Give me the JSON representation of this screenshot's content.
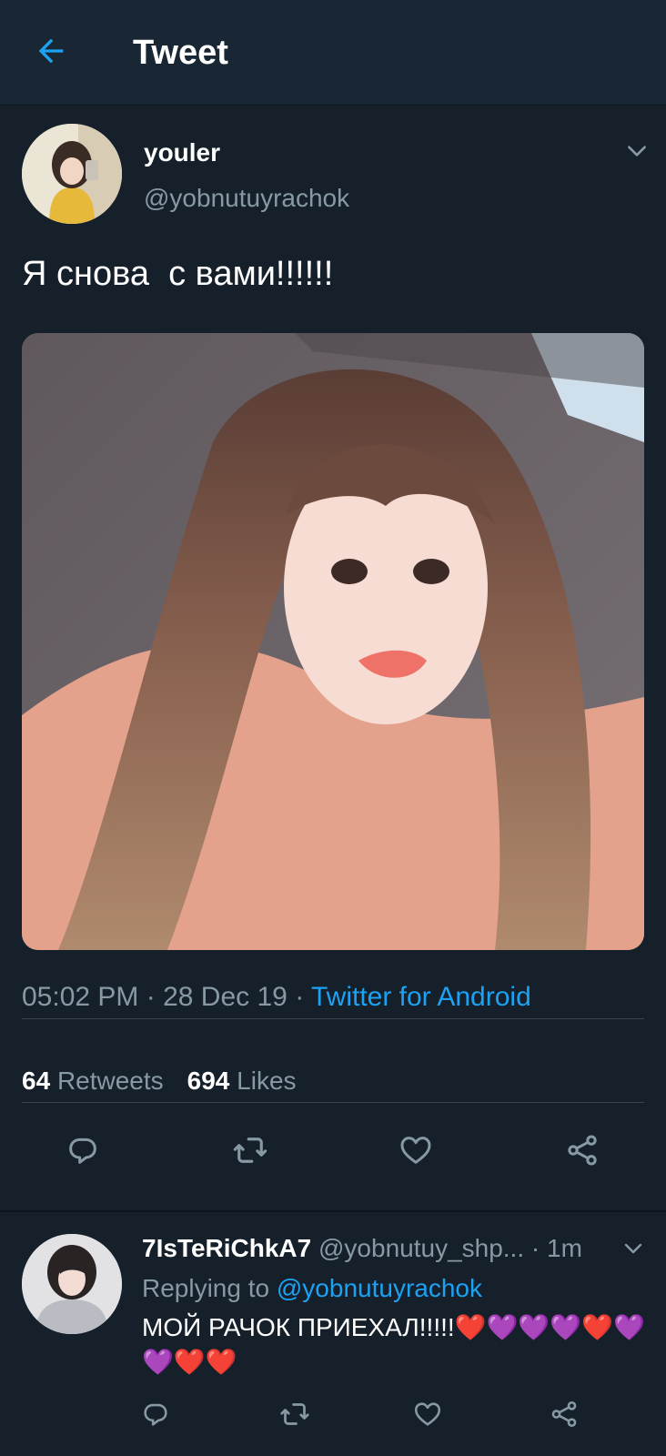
{
  "header": {
    "title": "Tweet",
    "back_icon": "arrow-left-icon",
    "accent_color": "#1da1f2"
  },
  "tweet": {
    "author_name": "youler",
    "author_handle": "@yobnutuyrachok",
    "text": "Я снова  с вами!!!!!!",
    "time": "05:02 PM",
    "date": "28 Dec 19",
    "separator": " · ",
    "source": "Twitter for Android",
    "retweet_count": "64",
    "retweets_label": "Retweets",
    "like_count": "694",
    "likes_label": "Likes",
    "actions": [
      "reply-icon",
      "retweet-icon",
      "like-icon",
      "share-icon"
    ]
  },
  "reply": {
    "author_name": "7IsTeRiChkA7",
    "author_handle": "@yobnutuy_shp...",
    "time": "· 1m",
    "replying_label": "Replying to",
    "replying_to": "@yobnutuyrachok",
    "text": "МОЙ РАЧОК ПРИЕХАЛ!!!!!❤️💜💜💜❤️💜💜❤️❤️"
  },
  "colors": {
    "background": "#15202b",
    "header_bg": "#192734",
    "muted": "#8899a6",
    "link": "#1da1f2"
  }
}
